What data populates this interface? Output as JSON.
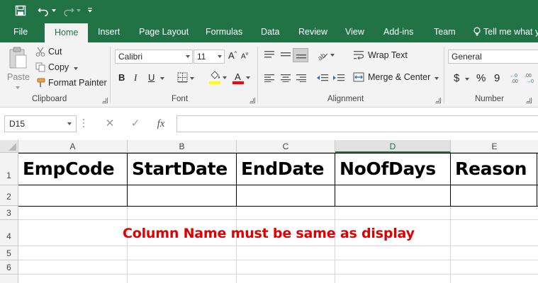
{
  "qat": {
    "save_icon": "save-icon",
    "undo_icon": "undo-icon",
    "redo_icon": "redo-icon",
    "customize_icon": "customize-qat-icon"
  },
  "tabs": [
    "File",
    "Home",
    "Insert",
    "Page Layout",
    "Formulas",
    "Data",
    "Review",
    "View",
    "Add-ins",
    "Team"
  ],
  "tell_me": "Tell me what y",
  "clipboard": {
    "paste": "Paste",
    "cut": "Cut",
    "copy": "Copy",
    "format_painter": "Format Painter",
    "label": "Clipboard"
  },
  "font": {
    "name": "Calibri",
    "size": "11",
    "bold": "B",
    "italic": "I",
    "underline": "U",
    "font_color_letter": "A",
    "label": "Font",
    "fill_color": "#ffff00",
    "text_color": "#ff0000"
  },
  "alignment": {
    "wrap_text": "Wrap Text",
    "merge_center": "Merge & Center",
    "label": "Alignment"
  },
  "number": {
    "format": "General",
    "currency": "$",
    "percent": "%",
    "comma": "9",
    "label": "Number"
  },
  "formula_bar": {
    "name_box": "D15",
    "cancel": "✕",
    "enter": "✓",
    "fx": "fx",
    "value": ""
  },
  "sheet": {
    "columns": [
      "A",
      "B",
      "C",
      "D",
      "E"
    ],
    "selected_column": "D",
    "rows": [
      "1",
      "2",
      "3",
      "4",
      "5",
      "6"
    ],
    "headers": [
      "EmpCode",
      "StartDate",
      "EndDate",
      "NoOfDays",
      "Reason"
    ],
    "note": "Column Name must be same as display"
  },
  "colors": {
    "accent": "#217346",
    "note": "#e00000"
  }
}
